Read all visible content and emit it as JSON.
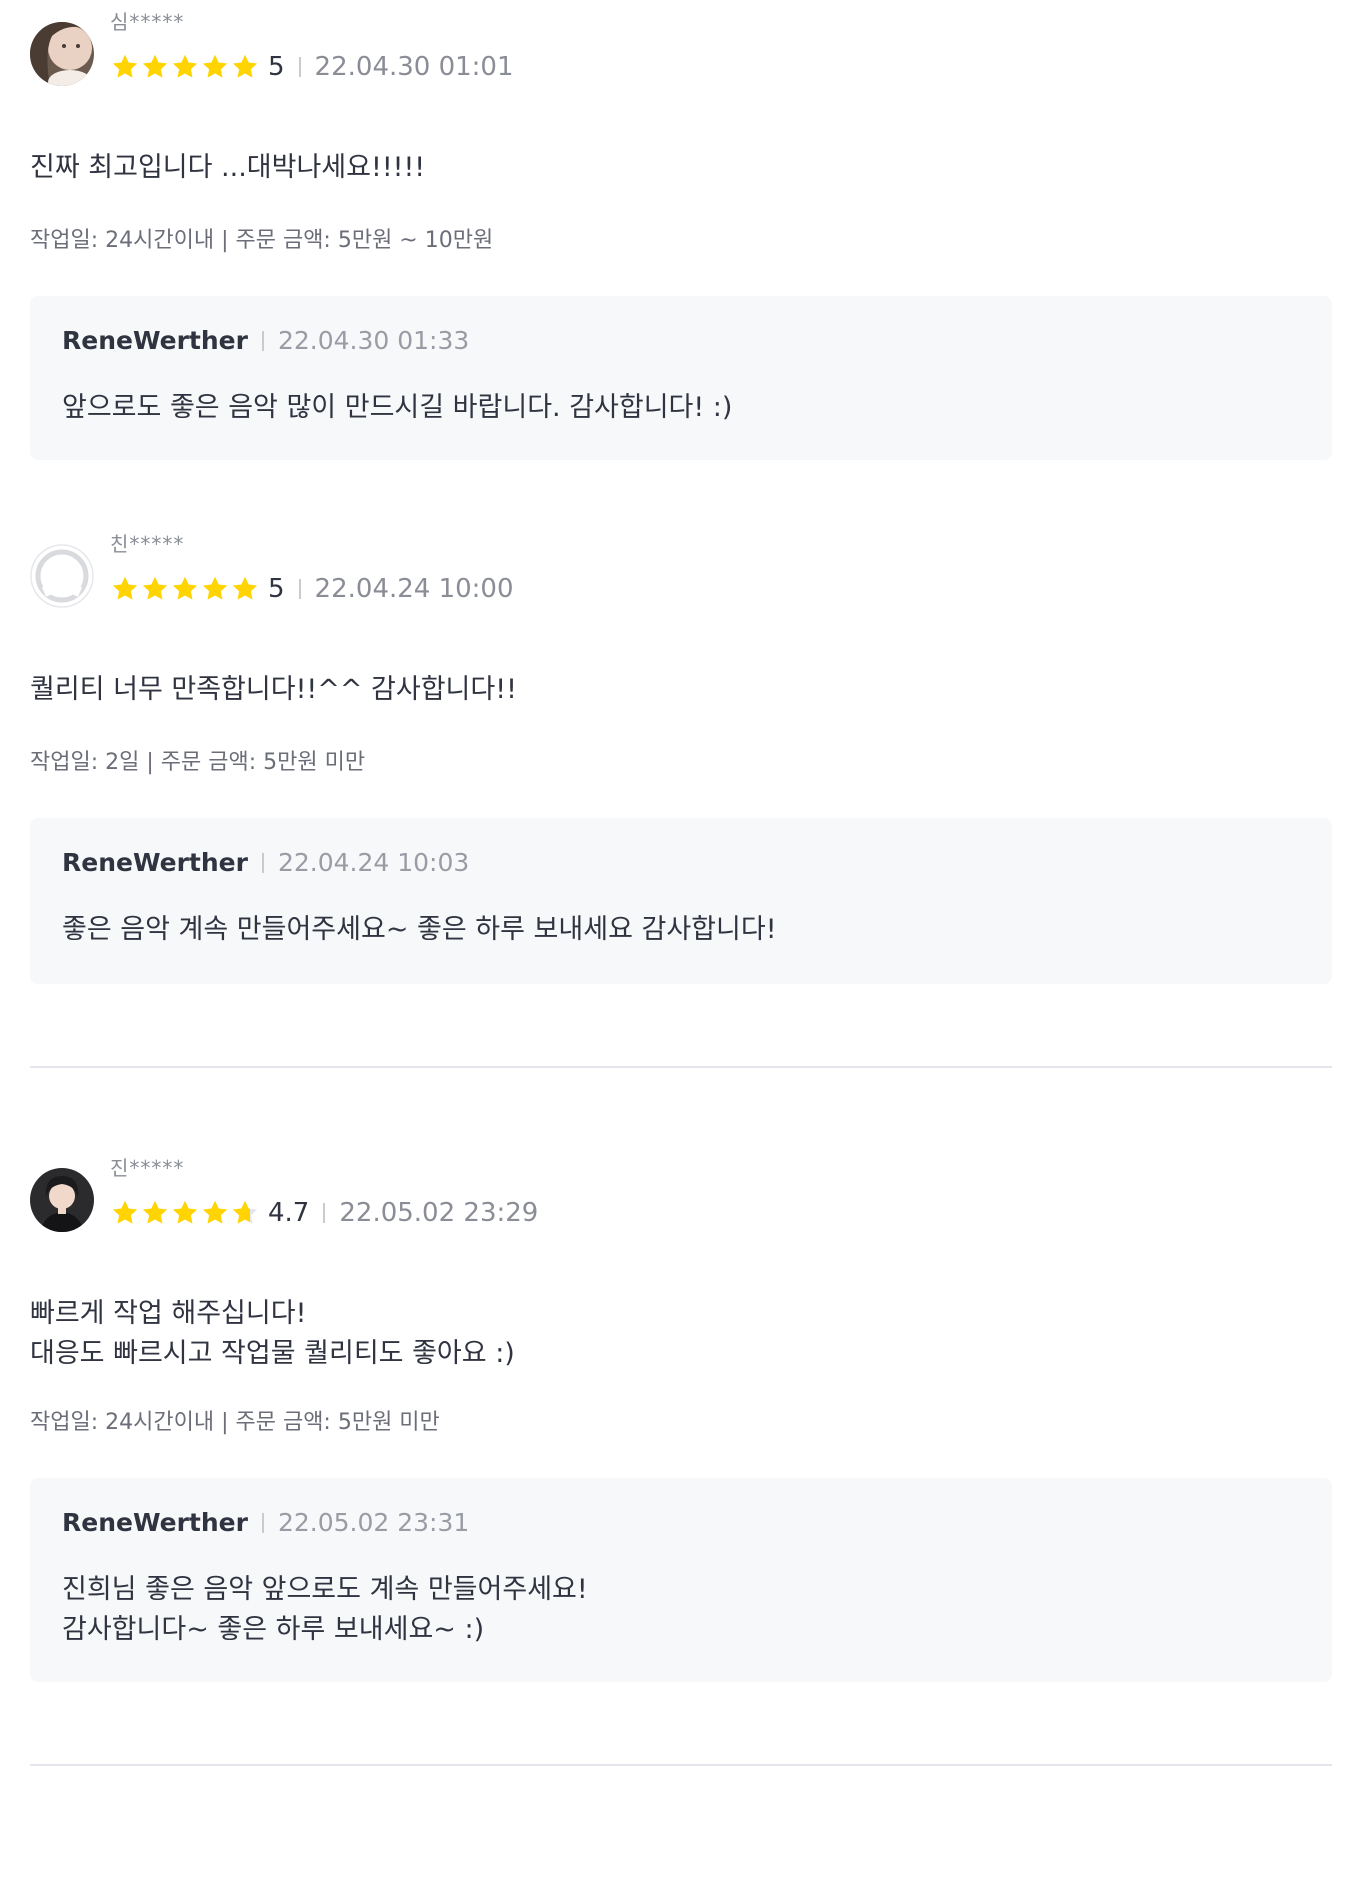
{
  "reviews": [
    {
      "avatar": "user-photo-avatar",
      "name": "심*****",
      "stars": 5,
      "rating": "5",
      "date": "22.04.30 01:01",
      "body": "진짜 최고입니다 ...대박나세요!!!!!",
      "meta": "작업일: 24시간이내 | 주문 금액: 5만원 ~ 10만원",
      "reply": {
        "author": "ReneWerther",
        "date": "22.04.30 01:33",
        "body": "앞으로도 좋은 음악 많이 만드시길 바랍니다. 감사합니다! :)"
      }
    },
    {
      "avatar": "default-user-avatar",
      "name": "친*****",
      "stars": 5,
      "rating": "5",
      "date": "22.04.24 10:00",
      "body": "퀄리티 너무 만족합니다!!^^ 감사합니다!!",
      "meta": "작업일: 2일 | 주문 금액: 5만원 미만",
      "reply": {
        "author": "ReneWerther",
        "date": "22.04.24 10:03",
        "body": "좋은 음악 계속 만들어주세요~ 좋은 하루 보내세요 감사합니다!"
      }
    },
    {
      "avatar": "user-photo-avatar",
      "name": "진*****",
      "stars": 4.7,
      "rating": "4.7",
      "date": "22.05.02 23:29",
      "body": "빠르게 작업 해주십니다!\n대응도 빠르시고 작업물 퀄리티도 좋아요 :)",
      "meta": "작업일: 24시간이내 | 주문 금액: 5만원 미만",
      "reply": {
        "author": "ReneWerther",
        "date": "22.05.02 23:31",
        "body": "진희님 좋은 음악 앞으로도 계속 만들어주세요!\n감사합니다~ 좋은 하루 보내세요~ :)"
      }
    }
  ],
  "colors": {
    "star": "#ffd400",
    "star_empty": "#e4e5ed",
    "reply_bg": "#f7f8fa",
    "divider": "#e4e5ed"
  }
}
